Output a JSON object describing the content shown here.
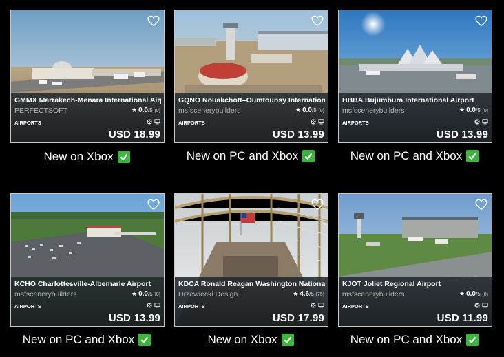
{
  "cards": [
    {
      "title": "GMMX Marrakech-Menara International Airport",
      "publisher": "PERFECTSOFT",
      "rating": "0.0",
      "rating_max": "/5",
      "rating_count": "(0)",
      "category": "AIRPORTS",
      "price": "USD 18.99",
      "caption": "New on Xbox"
    },
    {
      "title": "GQNO Nouakchott–Oumtounsy International Airport",
      "publisher": "msfscenerybuilders",
      "rating": "0.0",
      "rating_max": "/5",
      "rating_count": "(0)",
      "category": "AIRPORTS",
      "price": "USD 13.99",
      "caption": "New on PC and Xbox"
    },
    {
      "title": "HBBA Bujumbura International Airport",
      "publisher": "msfscenerybuilders",
      "rating": "0.0",
      "rating_max": "/5",
      "rating_count": "(0)",
      "category": "AIRPORTS",
      "price": "USD 13.99",
      "caption": "New on PC and Xbox"
    },
    {
      "title": "KCHO Charlottesville-Albemarle Airport",
      "publisher": "msfscenerybuilders",
      "rating": "0.0",
      "rating_max": "/5",
      "rating_count": "(0)",
      "category": "AIRPORTS",
      "price": "USD 13.99",
      "caption": "New on PC and Xbox"
    },
    {
      "title": "KDCA Ronald Reagan Washington National Airport",
      "publisher": "Drzewiecki Design",
      "rating": "4.6",
      "rating_max": "/5",
      "rating_count": "(75)",
      "category": "AIRPORTS",
      "price": "USD 17.99",
      "caption": "New on Xbox"
    },
    {
      "title": "KJOT Joliet Regional Airport",
      "publisher": "msfscenerybuilders",
      "rating": "0.0",
      "rating_max": "/5",
      "rating_count": "(0)",
      "category": "AIRPORTS",
      "price": "USD 11.99",
      "caption": "New on PC and Xbox"
    }
  ],
  "icons": {
    "wishlist": "heart-outline-icon",
    "rating": "star-icon",
    "platform_xbox": "xbox-icon",
    "platform_pc": "pc-icon",
    "caption_check": "check-mark-icon"
  },
  "colors": {
    "background": "#000000",
    "card_border": "#c8c8c8",
    "info_panel": "#242a30",
    "check_green": "#3db43d"
  }
}
